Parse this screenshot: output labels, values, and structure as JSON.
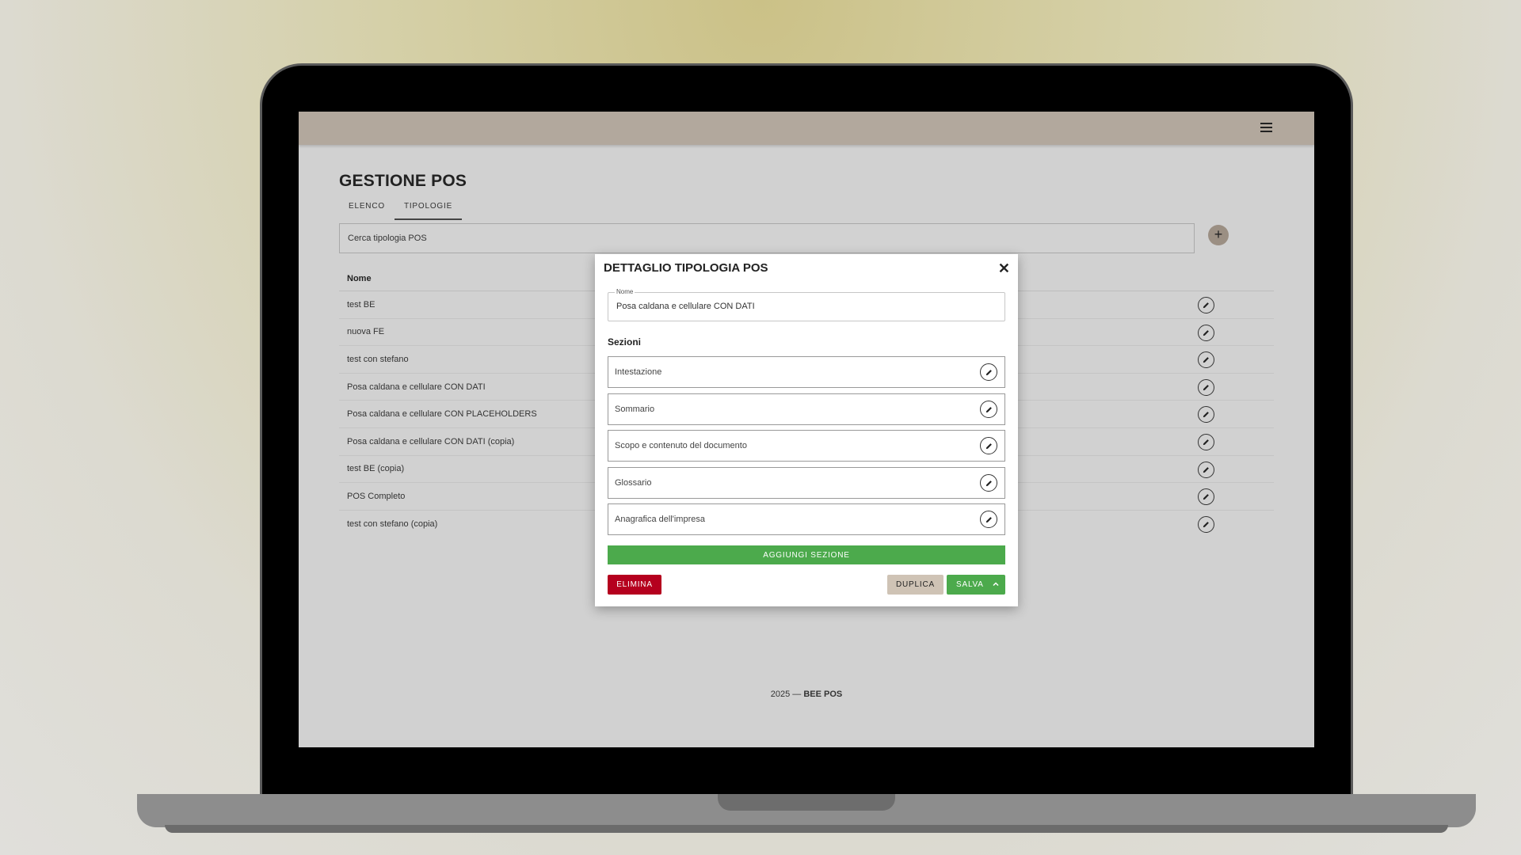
{
  "app": {
    "page_title": "GESTIONE POS",
    "tabs": [
      {
        "label": "ELENCO"
      },
      {
        "label": "TIPOLOGIE"
      }
    ],
    "search_placeholder": "Cerca tipologia POS",
    "add_icon": "plus-icon",
    "menu_icon": "hamburger-menu-icon"
  },
  "table": {
    "header": "Nome",
    "rows": [
      "test BE",
      "nuova FE",
      "test con stefano",
      "Posa caldana e cellulare CON DATI",
      "Posa caldana e cellulare CON PLACEHOLDERS",
      "Posa caldana e cellulare CON DATI (copia)",
      "test BE (copia)",
      "POS Completo",
      "test con stefano (copia)"
    ],
    "edit_icon": "pencil-icon"
  },
  "footer": {
    "year_text": "2025 — ",
    "brand": "BEE POS"
  },
  "modal": {
    "title": "DETTAGLIO TIPOLOGIA POS",
    "close_icon": "close-icon",
    "name_label": "Nome",
    "name_value": "Posa caldana e cellulare CON DATI",
    "sections_title": "Sezioni",
    "sections": [
      "Intestazione",
      "Sommario",
      "Scopo e contenuto del documento",
      "Glossario",
      "Anagrafica dell'impresa"
    ],
    "add_section_label": "AGGIUNGI SEZIONE",
    "delete_label": "ELIMINA",
    "duplicate_label": "DUPLICA",
    "save_label": "SALVA"
  },
  "colors": {
    "topbar": "#b2a89d",
    "green": "#4caa4c",
    "red": "#b5001e",
    "beige": "#cfc3b5"
  }
}
